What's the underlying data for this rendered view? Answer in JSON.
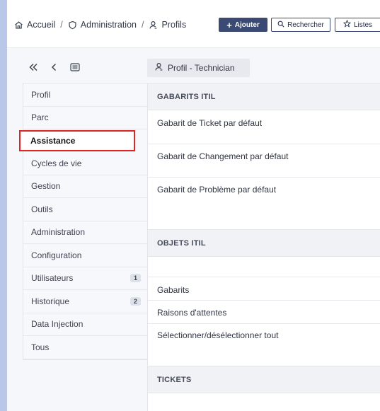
{
  "breadcrumb": {
    "home": "Accueil",
    "admin": "Administration",
    "profiles": "Profils",
    "separator": "/"
  },
  "toolbar": {
    "add_label": "Ajouter",
    "search_label": "Rechercher",
    "lists_label": "Listes"
  },
  "profile_tab": "Profil - Technician",
  "sidebar": {
    "items": [
      {
        "label": "Profil"
      },
      {
        "label": "Parc"
      },
      {
        "label": "Assistance",
        "active": true
      },
      {
        "label": "Cycles de vie"
      },
      {
        "label": "Gestion"
      },
      {
        "label": "Outils"
      },
      {
        "label": "Administration"
      },
      {
        "label": "Configuration"
      },
      {
        "label": "Utilisateurs",
        "badge": "1"
      },
      {
        "label": "Historique",
        "badge": "2"
      },
      {
        "label": "Data Injection"
      },
      {
        "label": "Tous"
      }
    ]
  },
  "main": {
    "itil_templates_header": "GABARITS ITIL",
    "ticket_template": "Gabarit de Ticket par défaut",
    "change_template": "Gabarit de Changement par défaut",
    "problem_template": "Gabarit de Problème par défaut",
    "itil_objects_header": "OBJETS ITIL",
    "templates": "Gabarits",
    "pending_reasons": "Raisons d'attentes",
    "select_all": "Sélectionner/désélectionner tout",
    "tickets_header": "TICKETS"
  },
  "colors": {
    "accent": "#3a4a72",
    "highlight_border": "#e02424",
    "background": "#b9c7e8"
  }
}
